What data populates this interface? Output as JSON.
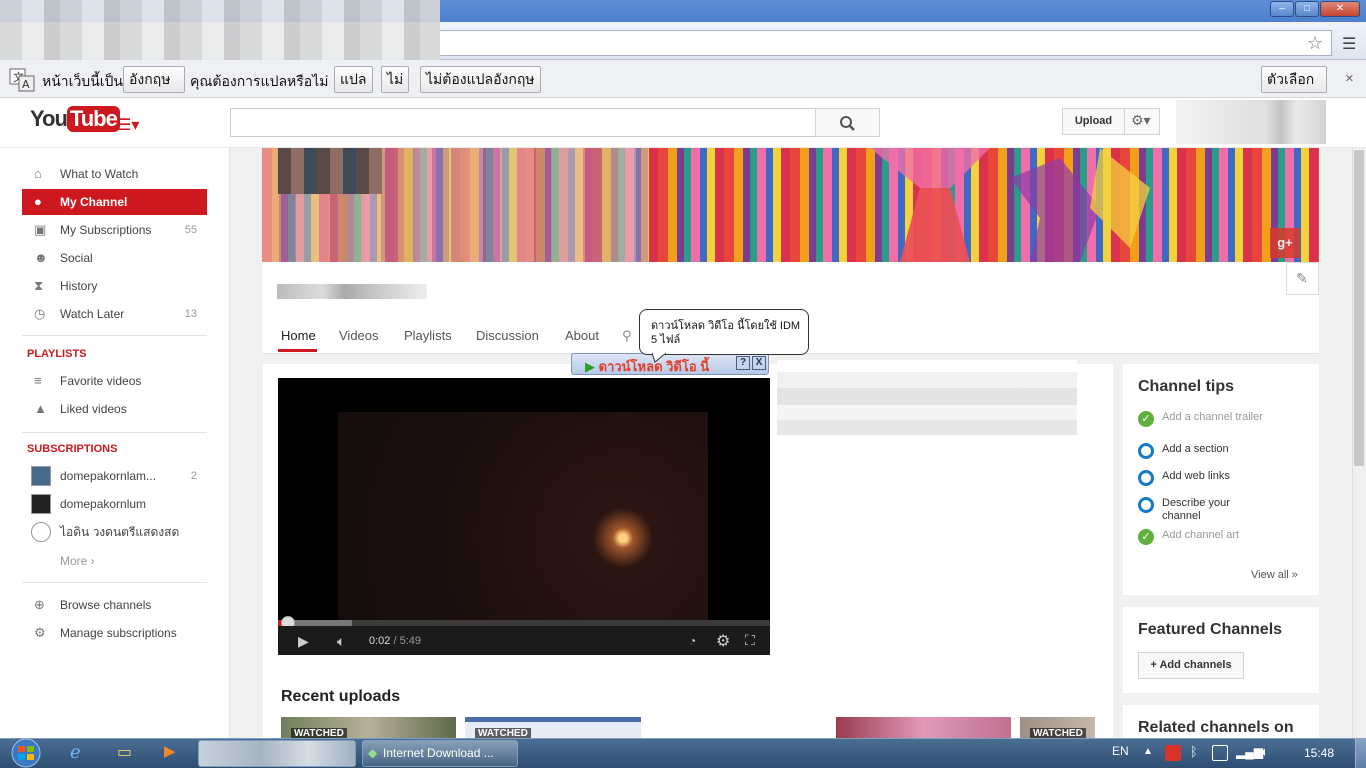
{
  "browser": {
    "window_controls": {
      "minimize": "–",
      "maximize": "□",
      "close": "✕"
    },
    "icons": {
      "bookmark": "star-icon",
      "menu": "hamburger-menu-icon"
    }
  },
  "translate_bar": {
    "page_is_in": "หน้าเว็บนี้เป็น",
    "language": "อังกฤษ",
    "question": "คุณต้องการแปลหรือไม่",
    "translate": "แปล",
    "no": "ไม่",
    "never": "ไม่ต้องแปลอังกฤษ",
    "options": "ตัวเลือก",
    "close": "×"
  },
  "youtube": {
    "logo_you": "You",
    "logo_tube": "Tube",
    "search_value": "",
    "upload": "Upload"
  },
  "sidebar": {
    "items": [
      {
        "label": "What to Watch",
        "icon": "home-icon",
        "count": ""
      },
      {
        "label": "My Channel",
        "icon": "user-icon",
        "count": "",
        "active": true
      },
      {
        "label": "My Subscriptions",
        "icon": "subscriptions-icon",
        "count": "55"
      },
      {
        "label": "Social",
        "icon": "people-icon",
        "count": ""
      },
      {
        "label": "History",
        "icon": "hourglass-icon",
        "count": ""
      },
      {
        "label": "Watch Later",
        "icon": "clock-icon",
        "count": "13"
      }
    ],
    "playlists_heading": "PLAYLISTS",
    "playlists": [
      {
        "label": "Favorite videos",
        "icon": "list-icon"
      },
      {
        "label": "Liked videos",
        "icon": "thumbs-up-icon"
      }
    ],
    "subscriptions_heading": "SUBSCRIPTIONS",
    "subscriptions": [
      {
        "label": "domepakornlam...",
        "count": "2"
      },
      {
        "label": "domepakornlum",
        "count": ""
      },
      {
        "label": "ไอดิน วงดนตรีแสดงสด",
        "count": ""
      }
    ],
    "more": "More ›",
    "footer": [
      {
        "label": "Browse channels",
        "icon": "plus-circle-icon"
      },
      {
        "label": "Manage subscriptions",
        "icon": "gear-icon"
      }
    ]
  },
  "channel": {
    "tabs": [
      "Home",
      "Videos",
      "Playlists",
      "Discussion",
      "About"
    ],
    "active_tab": "Home",
    "gplus": "g+"
  },
  "player": {
    "current_time": "0:02",
    "separator": " / ",
    "duration": "5:49",
    "progress_fraction": 0.006,
    "buffered_fraction": 0.15
  },
  "recent_uploads": {
    "title": "Recent uploads",
    "watched_label": "WATCHED"
  },
  "channel_tips": {
    "title": "Channel tips",
    "items": [
      {
        "label": "Add a channel trailer",
        "done": true
      },
      {
        "label": "Add a section",
        "done": false
      },
      {
        "label": "Add web links",
        "done": false
      },
      {
        "label": "Describe your channel",
        "done": false
      },
      {
        "label": "Add channel art",
        "done": true
      }
    ],
    "view_all": "View all  »"
  },
  "featured": {
    "title": "Featured Channels",
    "add_button": "+ Add channels"
  },
  "related": {
    "title": "Related channels on"
  },
  "idm": {
    "tooltip": "ดาวน์โหลด วิดีโอ นี้โดยใช้ IDM\n5 ไฟล์",
    "download_label": "ดาวน์โหลด วิดีโอ นี้",
    "help": "?",
    "close": "X"
  },
  "taskbar": {
    "task_idm": "Internet Download ...",
    "language": "EN",
    "clock": "15:48"
  }
}
